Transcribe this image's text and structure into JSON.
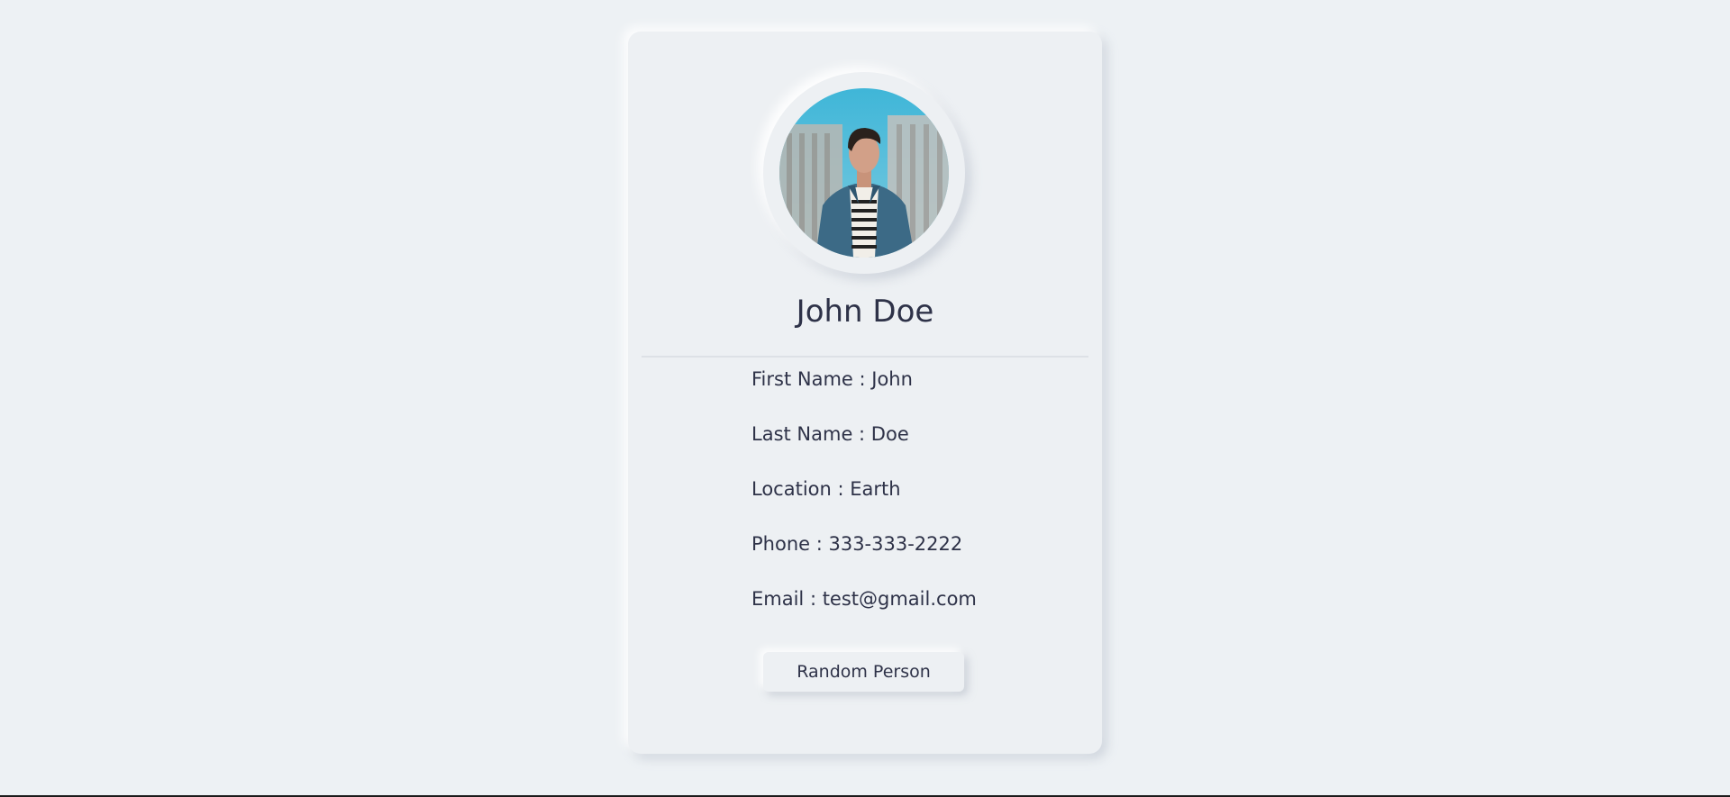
{
  "profile": {
    "full_name": "John Doe",
    "avatar_icon": "person-photo",
    "fields": [
      {
        "label": "First Name",
        "value": "John",
        "text": "First Name : John"
      },
      {
        "label": "Last Name",
        "value": "Doe",
        "text": "Last Name : Doe"
      },
      {
        "label": "Location",
        "value": "Earth",
        "text": "Location : Earth"
      },
      {
        "label": "Phone",
        "value": "333-333-2222",
        "text": "Phone : 333-333-2222"
      },
      {
        "label": "Email",
        "value": "test@gmail.com",
        "text": "Email : test@gmail.com"
      }
    ]
  },
  "actions": {
    "random_label": "Random Person"
  },
  "colors": {
    "background": "#edf1f4",
    "card": "#edf0f3",
    "text": "#2e3248"
  }
}
